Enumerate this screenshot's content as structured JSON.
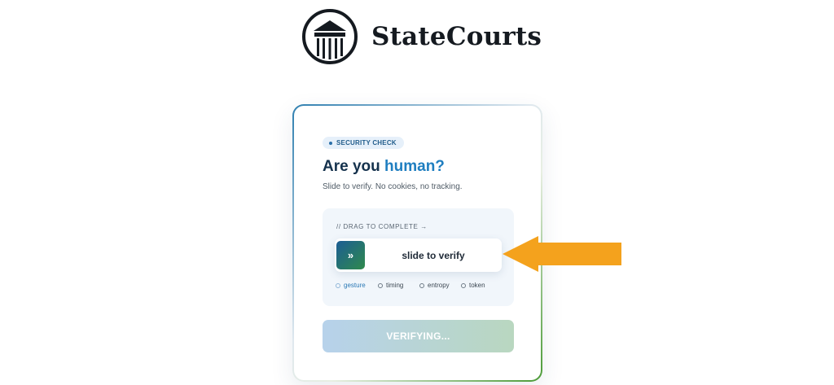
{
  "brand": {
    "name": "StateCourts"
  },
  "card": {
    "badge": "SECURITY CHECK",
    "heading_prefix": "Are you ",
    "heading_accent": "human?",
    "subtitle": "Slide to verify. No cookies, no tracking."
  },
  "challenge": {
    "label": "// DRAG TO COMPLETE →",
    "handle_glyph": "»",
    "slider_text": "slide to verify",
    "steps": [
      {
        "label": "gesture",
        "state": "active"
      },
      {
        "label": "timing",
        "state": "pending"
      },
      {
        "label": "entropy",
        "state": "pending"
      },
      {
        "label": "token",
        "state": "pending"
      }
    ]
  },
  "button": {
    "label": "VERIFYING..."
  },
  "colors": {
    "accent_blue": "#1f7ec0",
    "accent_green": "#2f8a4c",
    "arrow": "#f4a21d",
    "heading": "#15324d"
  },
  "icons": {
    "logo": "courthouse-columns-icon",
    "handle": "double-chevron-right-icon",
    "pointer": "arrow-left-icon"
  }
}
